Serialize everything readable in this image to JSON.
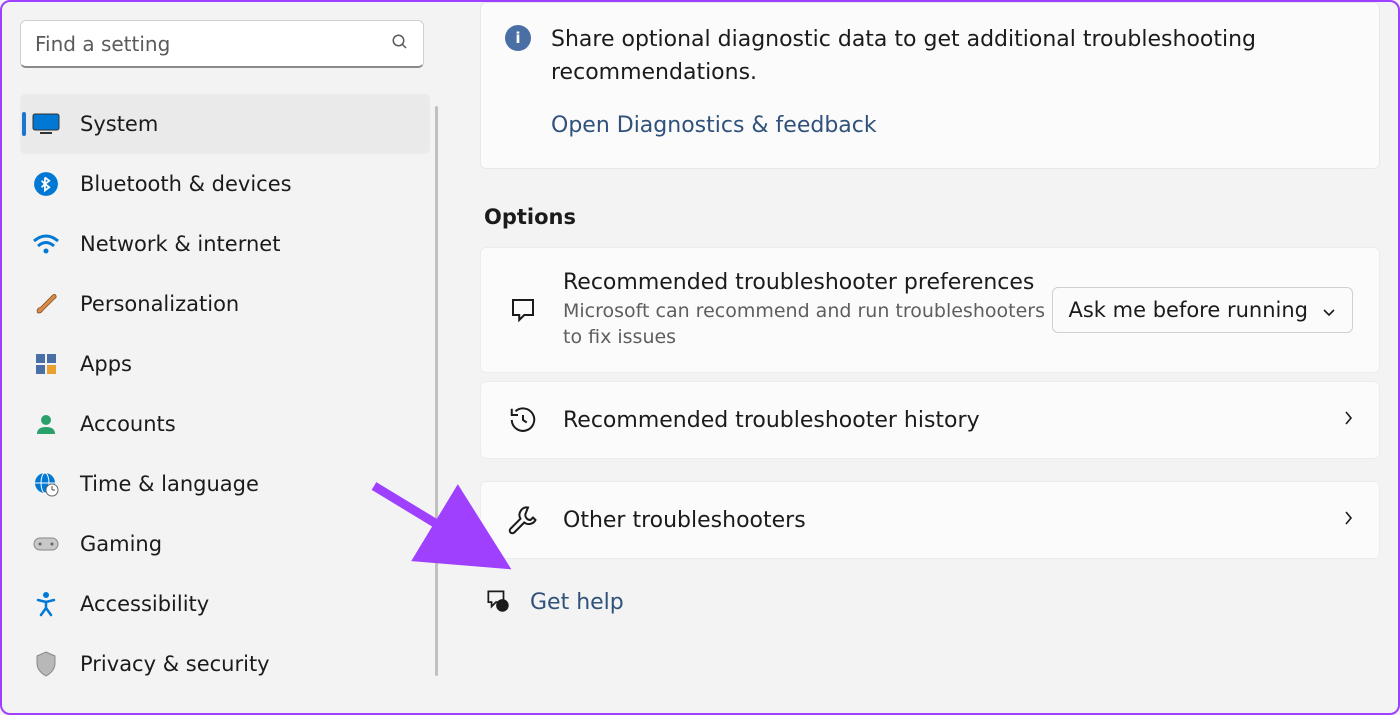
{
  "search": {
    "placeholder": "Find a setting"
  },
  "sidebar": {
    "items": [
      {
        "label": "System",
        "icon": "monitor"
      },
      {
        "label": "Bluetooth & devices",
        "icon": "bluetooth"
      },
      {
        "label": "Network & internet",
        "icon": "wifi"
      },
      {
        "label": "Personalization",
        "icon": "brush"
      },
      {
        "label": "Apps",
        "icon": "apps"
      },
      {
        "label": "Accounts",
        "icon": "person"
      },
      {
        "label": "Time & language",
        "icon": "globe-clock"
      },
      {
        "label": "Gaming",
        "icon": "gamepad"
      },
      {
        "label": "Accessibility",
        "icon": "accessibility"
      },
      {
        "label": "Privacy & security",
        "icon": "shield"
      }
    ]
  },
  "info": {
    "text": "Share optional diagnostic data to get additional troubleshooting recommendations.",
    "link": "Open Diagnostics & feedback"
  },
  "section_title": "Options",
  "cards": {
    "prefs": {
      "title": "Recommended troubleshooter preferences",
      "sub": "Microsoft can recommend and run troubleshooters to fix issues",
      "dropdown_value": "Ask me before running"
    },
    "history": {
      "title": "Recommended troubleshooter history"
    },
    "other": {
      "title": "Other troubleshooters"
    }
  },
  "help": {
    "label": "Get help"
  },
  "colors": {
    "accent": "#1976d2",
    "link": "#30527a",
    "info_badge": "#4a6fa5",
    "annotation": "#a040ff"
  }
}
